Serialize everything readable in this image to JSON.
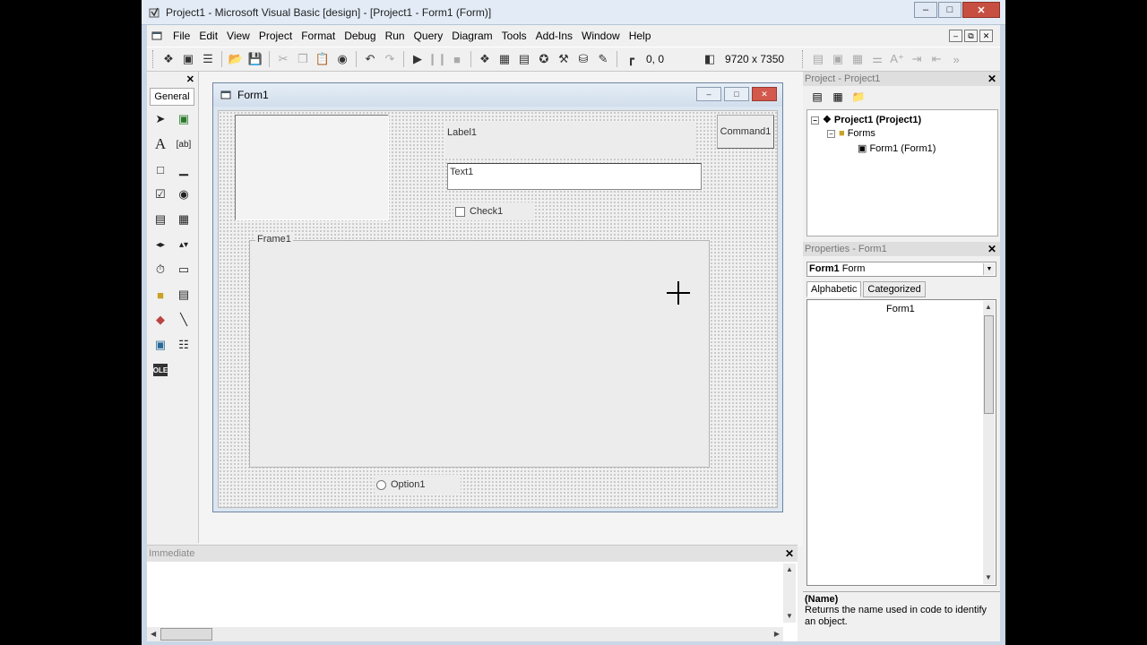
{
  "window": {
    "title": "Project1 - Microsoft Visual Basic [design] - [Project1 - Form1 (Form)]",
    "controls": [
      "minimize",
      "maximize",
      "close"
    ]
  },
  "menubar": {
    "items": [
      "File",
      "Edit",
      "View",
      "Project",
      "Format",
      "Debug",
      "Run",
      "Query",
      "Diagram",
      "Tools",
      "Add-Ins",
      "Window",
      "Help"
    ]
  },
  "toolbar": {
    "position": "0, 0",
    "size": "9720 x 7350"
  },
  "toolbox": {
    "tab_label": "General",
    "tools": [
      "pointer",
      "picturebox",
      "label",
      "textbox",
      "frame",
      "commandbutton",
      "checkbox",
      "optionbutton",
      "combobox",
      "listbox",
      "hscrollbar",
      "vscrollbar",
      "timer",
      "drivelistbox",
      "dirlistbox",
      "filelistbox",
      "shape",
      "line",
      "image",
      "data",
      "ole"
    ]
  },
  "form": {
    "title": "Form1",
    "controls": {
      "label": "Label1",
      "command": "Command1",
      "text": "Text1",
      "check": "Check1",
      "frame": "Frame1",
      "option": "Option1"
    }
  },
  "immediate": {
    "title": "Immediate"
  },
  "project": {
    "title": "Project - Project1",
    "tree": {
      "root": "Project1 (Project1)",
      "folder": "Forms",
      "item": "Form1 (Form1)"
    }
  },
  "properties": {
    "title": "Properties - Form1",
    "object_name": "Form1",
    "object_type": "Form",
    "tabs": [
      "Alphabetic",
      "Categorized"
    ],
    "selected_value": "Form1",
    "desc_name": "(Name)",
    "desc_text": "Returns the name used in code to identify an object."
  },
  "colors": {
    "titlebar": "#e3ecf6",
    "close_button": "#c74f41",
    "form_grid": "#9a9a9a"
  }
}
